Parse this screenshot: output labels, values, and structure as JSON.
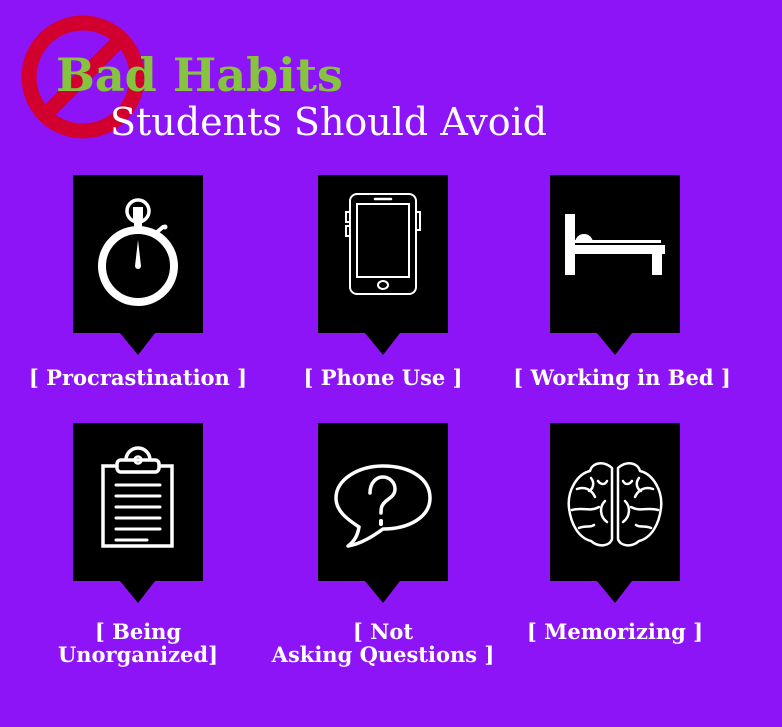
{
  "header": {
    "title": "Bad Habits",
    "subtitle": "Students Should Avoid",
    "icon": "prohibited-icon",
    "title_color": "#86C440",
    "icon_color": "#D1002E"
  },
  "background_color": "#8E14F8",
  "cards": [
    {
      "label": "[ Procrastination ]",
      "icon": "stopwatch-icon"
    },
    {
      "label": "[ Phone Use ]",
      "icon": "smartphone-icon"
    },
    {
      "label": "[ Working in Bed ]",
      "icon": "bed-icon"
    },
    {
      "label_line1": "[ Being",
      "label_line2": "Unorganized]",
      "icon": "clipboard-icon"
    },
    {
      "label_line1": "[ Not",
      "label_line2": "Asking Questions ]",
      "icon": "question-bubble-icon"
    },
    {
      "label": "[ Memorizing ]",
      "icon": "brain-icon"
    }
  ]
}
